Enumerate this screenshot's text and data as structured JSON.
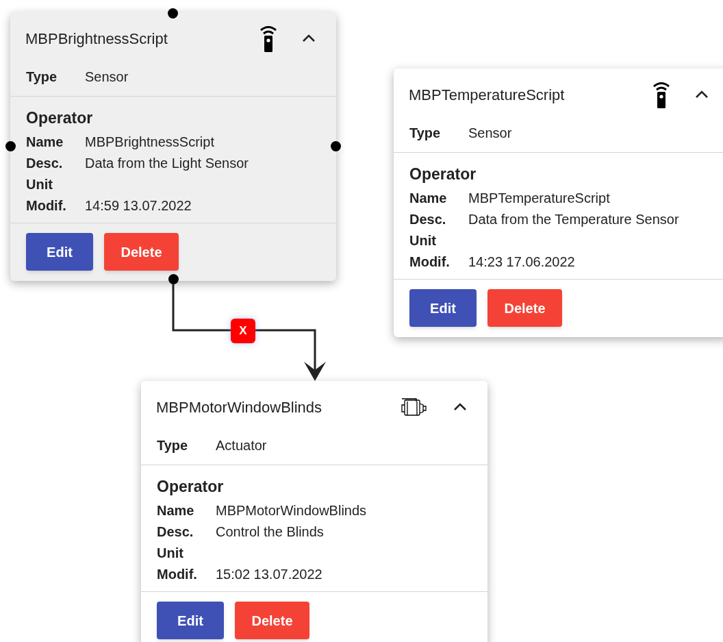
{
  "nodes": [
    {
      "title": "MBPBrightnessScript",
      "kind": "sensor",
      "selected": true,
      "expanded": true,
      "type_label": "Type",
      "type_value": "Sensor",
      "section": "Operator",
      "fields": [
        {
          "label": "Name",
          "value": "MBPBrightnessScript"
        },
        {
          "label": "Desc.",
          "value": "Data from the Light Sensor"
        },
        {
          "label": "Unit"
        },
        {
          "label": "Modif.",
          "value": "14:59 13.07.2022"
        }
      ],
      "buttons": [
        "Edit",
        "Delete"
      ]
    },
    {
      "title": "MBPTemperatureScript",
      "kind": "sensor",
      "selected": false,
      "expanded": true,
      "type_label": "Type",
      "type_value": "Sensor",
      "section": "Operator",
      "fields": [
        {
          "label": "Name",
          "value": "MBPTemperatureScript"
        },
        {
          "label": "Desc.",
          "value": "Data from the Temperature Sensor"
        },
        {
          "label": "Unit"
        },
        {
          "label": "Modif.",
          "value": "14:23 17.06.2022"
        }
      ],
      "buttons": [
        "Edit",
        "Delete"
      ]
    },
    {
      "title": "MBPMotorWindowBlinds",
      "kind": "actuator",
      "selected": false,
      "expanded": true,
      "type_label": "Type",
      "type_value": "Actuator",
      "section": "Operator",
      "fields": [
        {
          "label": "Name",
          "value": "MBPMotorWindowBlinds"
        },
        {
          "label": "Desc.",
          "value": "Control the Blinds"
        },
        {
          "label": "Unit"
        },
        {
          "label": "Modif.",
          "value": "15:02 13.07.2022"
        }
      ],
      "buttons": [
        "Edit",
        "Delete"
      ]
    }
  ],
  "edges": [
    {
      "delete_label": "X"
    }
  ]
}
